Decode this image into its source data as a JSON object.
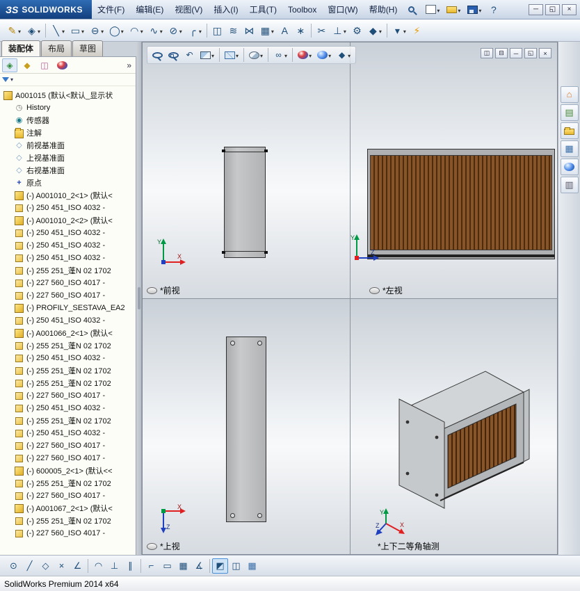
{
  "titlebar": {
    "logo_mark": "ЗS",
    "logo_text": "SOLIDWORKS",
    "menus": [
      "文件(F)",
      "编辑(E)",
      "视图(V)",
      "插入(I)",
      "工具(T)",
      "Toolbox",
      "窗口(W)",
      "帮助(H)"
    ],
    "quick_icons": [
      {
        "name": "new-document-button",
        "icon": "newdoc",
        "caret": true
      },
      {
        "name": "open-document-button",
        "icon": "open",
        "caret": true
      },
      {
        "name": "save-document-button",
        "icon": "save",
        "caret": true
      },
      {
        "name": "help-button",
        "glyph": "?",
        "color": "#1f4e79"
      }
    ],
    "window_buttons": [
      {
        "name": "minimize-window-button",
        "glyph": "─"
      },
      {
        "name": "restore-window-button",
        "glyph": "◱"
      },
      {
        "name": "close-window-button",
        "glyph": "×"
      }
    ]
  },
  "toolbar2": {
    "items": [
      {
        "name": "sketch-button",
        "glyph": "✎",
        "color": "#b8860b",
        "caret": true
      },
      {
        "name": "smart-dimension-button",
        "glyph": "◈",
        "caret": true
      },
      {
        "sep": true
      },
      {
        "name": "line-tool",
        "glyph": "╲",
        "caret": true
      },
      {
        "name": "corner-rectangle-tool",
        "glyph": "▭",
        "caret": true
      },
      {
        "name": "straight-slot-tool",
        "glyph": "⊖",
        "caret": true
      },
      {
        "name": "circle-tool",
        "glyph": "◯",
        "caret": true
      },
      {
        "name": "arc-tool",
        "glyph": "◠",
        "caret": true
      },
      {
        "name": "spline-tool",
        "glyph": "∿",
        "caret": true
      },
      {
        "name": "ellipse-tool",
        "glyph": "⊘",
        "caret": true
      },
      {
        "name": "sketch-fillet-tool",
        "glyph": "╭",
        "caret": true
      },
      {
        "sep": true
      },
      {
        "name": "convert-entities-tool",
        "glyph": "◫"
      },
      {
        "name": "offset-entities-tool",
        "glyph": "≋"
      },
      {
        "name": "mirror-entities-tool",
        "glyph": "⋈"
      },
      {
        "name": "linear-sketch-pattern-tool",
        "glyph": "▦",
        "caret": true
      },
      {
        "name": "sketch-text-tool",
        "glyph": "A"
      },
      {
        "name": "point-tool",
        "glyph": "∗"
      },
      {
        "sep": true
      },
      {
        "name": "trim-entities-tool",
        "glyph": "✂"
      },
      {
        "name": "display-delete-relations-button",
        "glyph": "⊥",
        "caret": true
      },
      {
        "name": "repair-sketch-button",
        "glyph": "⚙"
      },
      {
        "name": "quick-snaps-button",
        "glyph": "◆",
        "caret": true
      },
      {
        "sep": true
      },
      {
        "name": "sketch-settings-dropdown",
        "glyph": "▾",
        "caret": true
      },
      {
        "name": "instant3d-button",
        "glyph": "⚡",
        "color": "#e89b00"
      }
    ]
  },
  "left_panel": {
    "tabs": [
      {
        "name": "tab-assembly",
        "label": "装配体",
        "active": true
      },
      {
        "name": "tab-layout",
        "label": "布局"
      },
      {
        "name": "tab-sketch",
        "label": "草图"
      }
    ],
    "panel_tabs": [
      {
        "name": "featuremanager-tree-tab",
        "glyph": "◈",
        "color": "#2f8a3a",
        "active": true
      },
      {
        "name": "propertymanager-tab",
        "glyph": "◆",
        "color": "#c8a020"
      },
      {
        "name": "configurationmanager-tab",
        "glyph": "◫",
        "color": "#b05090"
      },
      {
        "name": "displaymanager-tab",
        "icon": "ball-multi"
      }
    ],
    "overflow_glyph": "»",
    "tree": {
      "items": [
        {
          "label": "A001015  (默认<默认_显示状",
          "icon": "asm"
        },
        {
          "label": "History",
          "icon": "history",
          "glyph": "◷",
          "child": true
        },
        {
          "label": "传感器",
          "icon": "sensors",
          "glyph": "◉",
          "child": true
        },
        {
          "label": "注解",
          "icon": "folder",
          "child": true
        },
        {
          "label": "前视基准面",
          "icon": "plane",
          "glyph": "◇",
          "child": true
        },
        {
          "label": "上视基准面",
          "icon": "plane",
          "glyph": "◇",
          "child": true
        },
        {
          "label": "右视基准面",
          "icon": "plane",
          "glyph": "◇",
          "child": true
        },
        {
          "label": "原点",
          "icon": "origin",
          "glyph": "+",
          "child": true
        },
        {
          "label": "(-) A001010_2<1> (默认<",
          "icon": "asm",
          "child": true
        },
        {
          "label": "(-) 250 451_ISO 4032 -",
          "icon": "part",
          "child": true
        },
        {
          "label": "(-) A001010_2<2> (默认<",
          "icon": "asm",
          "child": true
        },
        {
          "label": "(-) 250 451_ISO 4032 -",
          "icon": "part",
          "child": true
        },
        {
          "label": "(-) 250 451_ISO 4032 -",
          "icon": "part",
          "child": true
        },
        {
          "label": "(-) 250 451_ISO 4032 -",
          "icon": "part",
          "child": true
        },
        {
          "label": "(-) 255 251_蓬N 02 1702",
          "icon": "part",
          "child": true
        },
        {
          "label": "(-) 227 560_ISO 4017 -",
          "icon": "part",
          "child": true
        },
        {
          "label": "(-) 227 560_ISO 4017 -",
          "icon": "part",
          "child": true
        },
        {
          "label": "(-) PROFILY_SESTAVA_EA2",
          "icon": "asm",
          "child": true
        },
        {
          "label": "(-) 250 451_ISO 4032 -",
          "icon": "part",
          "child": true
        },
        {
          "label": "(-) A001066_2<1> (默认<",
          "icon": "asm",
          "child": true
        },
        {
          "label": "(-) 255 251_蓬N 02 1702",
          "icon": "part",
          "child": true
        },
        {
          "label": "(-) 250 451_ISO 4032 -",
          "icon": "part",
          "child": true
        },
        {
          "label": "(-) 255 251_蓬N 02 1702",
          "icon": "part",
          "child": true
        },
        {
          "label": "(-) 255 251_蓬N 02 1702",
          "icon": "part",
          "child": true
        },
        {
          "label": "(-) 227 560_ISO 4017 -",
          "icon": "part",
          "child": true
        },
        {
          "label": "(-) 250 451_ISO 4032 -",
          "icon": "part",
          "child": true
        },
        {
          "label": "(-) 255 251_蓬N 02 1702",
          "icon": "part",
          "child": true
        },
        {
          "label": "(-) 250 451_ISO 4032 -",
          "icon": "part",
          "child": true
        },
        {
          "label": "(-) 227 560_ISO 4017 -",
          "icon": "part",
          "child": true
        },
        {
          "label": "(-) 227 560_ISO 4017 -",
          "icon": "part",
          "child": true
        },
        {
          "label": "(-) 600005_2<1> (默认<<",
          "icon": "asm",
          "child": true
        },
        {
          "label": "(-) 255 251_蓬N 02 1702",
          "icon": "part",
          "child": true
        },
        {
          "label": "(-) 227 560_ISO 4017 -",
          "icon": "part",
          "child": true
        },
        {
          "label": "(-) A001067_2<1> (默认<",
          "icon": "asm",
          "child": true
        },
        {
          "label": "(-) 255 251_蓬N 02 1702",
          "icon": "part",
          "child": true
        },
        {
          "label": "(-) 227 560_ISO 4017 -",
          "icon": "part",
          "child": true
        }
      ]
    }
  },
  "viewport": {
    "toolbar": {
      "items": [
        {
          "name": "zoom-fit-button",
          "icon": "mag"
        },
        {
          "name": "zoom-area-button",
          "icon": "magrect"
        },
        {
          "name": "previous-view-button",
          "glyph": "↶"
        },
        {
          "name": "section-view-button",
          "icon": "section",
          "caret": true
        },
        {
          "sep": true
        },
        {
          "name": "view-orientation-button",
          "icon": "cube",
          "caret": true
        },
        {
          "sep": true
        },
        {
          "name": "display-style-button",
          "icon": "dispstyle",
          "caret": true
        },
        {
          "sep": true
        },
        {
          "name": "hide-show-items-button",
          "glyph": "∞",
          "caret": true
        },
        {
          "sep": true
        },
        {
          "name": "edit-appearance-button",
          "icon": "ball-multi",
          "caret": true
        },
        {
          "name": "apply-scene-button",
          "icon": "ball-blue",
          "caret": true
        },
        {
          "name": "view-settings-button",
          "glyph": "◆",
          "caret": true
        }
      ]
    },
    "doc_controls": {
      "items": [
        {
          "name": "tile-left-button",
          "glyph": "◫"
        },
        {
          "name": "tile-right-button",
          "glyph": "⊟"
        },
        {
          "name": "minimize-document-button",
          "glyph": "─"
        },
        {
          "name": "restore-document-button",
          "glyph": "◱"
        },
        {
          "name": "close-document-button",
          "glyph": "×"
        }
      ]
    },
    "views": [
      {
        "label": "*前视",
        "axis_v": "Y",
        "axis_h": "X"
      },
      {
        "label": "*左视",
        "axis_v": "Y",
        "axis_h": "Z"
      },
      {
        "label": "*上视",
        "axis_h": "X",
        "axis_d": "Z"
      },
      {
        "label": "*上下二等角轴测",
        "axis_v": "Y",
        "axis_h": "X",
        "axis_d": "Z"
      }
    ]
  },
  "task_pane": {
    "items": [
      {
        "name": "solidworks-resources-button",
        "glyph": "⌂",
        "color": "#e07820"
      },
      {
        "name": "design-library-button",
        "glyph": "▤",
        "color": "#4a8a3a"
      },
      {
        "name": "file-explorer-button",
        "icon": "folder"
      },
      {
        "name": "view-palette-button",
        "glyph": "▦",
        "color": "#3a6ea8"
      },
      {
        "name": "appearances-scenes-button",
        "icon": "ball-blue"
      },
      {
        "name": "custom-properties-button",
        "glyph": "▥",
        "color": "#556"
      }
    ]
  },
  "bottom_bar": {
    "items": [
      {
        "name": "quick-snap-point",
        "glyph": "⊙"
      },
      {
        "name": "quick-snap-line",
        "glyph": "╱"
      },
      {
        "name": "quick-snap-quadrant",
        "glyph": "◇"
      },
      {
        "name": "quick-snap-intersection",
        "glyph": "×"
      },
      {
        "name": "quick-snap-nearest",
        "glyph": "∠"
      },
      {
        "sep": true
      },
      {
        "name": "quick-snap-tangent",
        "glyph": "◠"
      },
      {
        "name": "quick-snap-perpendicular",
        "glyph": "⊥"
      },
      {
        "name": "quick-snap-parallel",
        "glyph": "∥"
      },
      {
        "sep": true
      },
      {
        "name": "quick-snap-hv",
        "glyph": "⌐"
      },
      {
        "name": "quick-snap-length",
        "glyph": "▭"
      },
      {
        "name": "grid-snap",
        "glyph": "▦"
      },
      {
        "name": "angle-snap",
        "glyph": "∡"
      },
      {
        "sep": true
      },
      {
        "name": "3d-view-mode-button",
        "glyph": "◩",
        "active": true
      },
      {
        "name": "viewport-layout-button",
        "glyph": "◫"
      },
      {
        "name": "grid-table-button",
        "glyph": "▦",
        "color": "#3a6ea8"
      }
    ]
  },
  "statusbar": {
    "text": "SolidWorks Premium 2014 x64"
  }
}
